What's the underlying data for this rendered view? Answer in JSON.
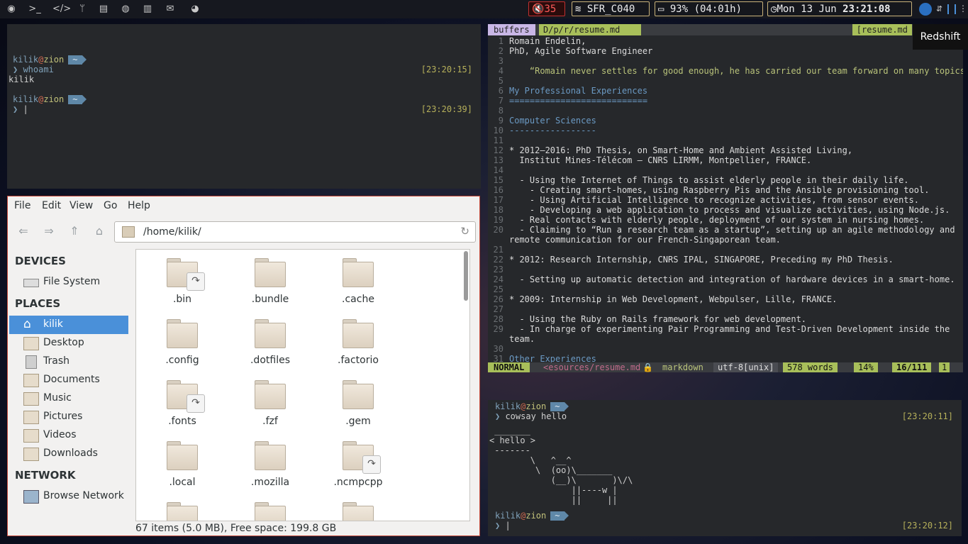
{
  "topbar": {
    "launchers": [
      "chrome-icon",
      "terminal-icon",
      "code-icon",
      "git-icon",
      "notes-icon",
      "spotify-icon",
      "trash-icon",
      "mail-icon",
      "firefox-icon"
    ],
    "volume": "35",
    "wifi": "SFR_C040",
    "battery": "93% (04:01h)",
    "date": "Mon 13 Jun",
    "time": "23:21:08"
  },
  "term1": {
    "user": "kilik",
    "at": "@",
    "host": "zion",
    "tilde": "~",
    "cmd1": "whoami",
    "out1": "kilik",
    "time1": "[23:20:15]",
    "time2": "[23:20:39]",
    "cursor": "|"
  },
  "fm": {
    "menu": [
      "File",
      "Edit",
      "View",
      "Go",
      "Help"
    ],
    "path": "/home/kilik/",
    "sections": {
      "devices": "DEVICES",
      "places": "PLACES",
      "network": "NETWORK"
    },
    "devices": [
      "File System"
    ],
    "places": [
      "kilik",
      "Desktop",
      "Trash",
      "Documents",
      "Music",
      "Pictures",
      "Videos",
      "Downloads"
    ],
    "network": [
      "Browse Network"
    ],
    "items": [
      ".bin",
      ".bundle",
      ".cache",
      ".config",
      ".dotfiles",
      ".factorio",
      ".fonts",
      ".fzf",
      ".gem",
      ".local",
      ".mozilla",
      ".ncmpcpp",
      "",
      "",
      ""
    ],
    "status": "67 items (5.0 MB), Free space: 199.8 GB"
  },
  "vim": {
    "tab_buffers": "buffers",
    "tab_path": "D/p/r/resume.md",
    "tab_right": "[resume.md",
    "lines": [
      {
        "n": "1",
        "t": "Romain Endelin,"
      },
      {
        "n": "2",
        "t": "PhD, Agile Software Engineer"
      },
      {
        "n": "3",
        "t": ""
      },
      {
        "n": "4",
        "t": "    “Romain never settles for good enough, he has carried our team forward on many topics”"
      },
      {
        "n": "5",
        "t": ""
      },
      {
        "n": "6",
        "t": "My Professional Experiences"
      },
      {
        "n": "7",
        "t": "==========================="
      },
      {
        "n": "8",
        "t": ""
      },
      {
        "n": "9",
        "t": "Computer Sciences"
      },
      {
        "n": "10",
        "t": "-----------------"
      },
      {
        "n": "11",
        "t": ""
      },
      {
        "n": "12",
        "t": "* 2012–2016: PhD Thesis, on Smart-Home and Ambient Assisted Living,"
      },
      {
        "n": "13",
        "t": "  Institut Mines-Télécom — CNRS LIRMM, Montpellier, FRANCE."
      },
      {
        "n": "14",
        "t": ""
      },
      {
        "n": "15",
        "t": "  - Using the Internet of Things to assist elderly people in their daily life."
      },
      {
        "n": "16",
        "t": "    - Creating smart-homes, using Raspberry Pis and the Ansible provisioning tool."
      },
      {
        "n": "17",
        "t": "    - Using Artificial Intelligence to recognize activities, from sensor events."
      },
      {
        "n": "18",
        "t": "    - Developing a web application to process and visualize activities, using Node.js."
      },
      {
        "n": "19",
        "t": "  - Real contacts with elderly people, deployment of our system in nursing homes."
      },
      {
        "n": "20",
        "t": "  - Claiming to “Run a research team as a startup”, setting up an agile methodology and"
      },
      {
        "n": "",
        "t": "remote communication for our French-Singaporean team."
      },
      {
        "n": "21",
        "t": ""
      },
      {
        "n": "22",
        "t": "* 2012: Research Internship, CNRS IPAL, SINGAPORE, Preceding my PhD Thesis."
      },
      {
        "n": "23",
        "t": ""
      },
      {
        "n": "24",
        "t": "  - Setting up automatic detection and integration of hardware devices in a smart-home."
      },
      {
        "n": "25",
        "t": ""
      },
      {
        "n": "26",
        "t": "* 2009: Internship in Web Development, Webpulser, Lille, FRANCE."
      },
      {
        "n": "27",
        "t": ""
      },
      {
        "n": "28",
        "t": "  - Using the Ruby on Rails framework for web development."
      },
      {
        "n": "29",
        "t": "  - In charge of experimenting Pair Programming and Test-Driven Development inside the"
      },
      {
        "n": "",
        "t": "team."
      },
      {
        "n": "30",
        "t": ""
      },
      {
        "n": "31",
        "t": "Other Experiences"
      }
    ],
    "status": {
      "mode": "NORMAL",
      "file": "<esources/resume.md",
      "lock": "🔒",
      "ft": "markdown",
      "enc": "utf-8[unix]",
      "words": "578 words",
      "pct": "14%",
      "pos": "16/111",
      "col": "1"
    }
  },
  "term2": {
    "user": "kilik",
    "at": "@",
    "host": "zion",
    "tilde": "~",
    "cmd": "cowsay hello",
    "time1": "[23:20:11]",
    "time2": "[23:20:12]",
    "cow": [
      " _______",
      "< hello >",
      " -------",
      "        \\   ^__^",
      "         \\  (oo)\\_______",
      "            (__)\\       )\\/\\",
      "                ||----w |",
      "                ||     ||"
    ]
  },
  "redshift": "Redshift"
}
